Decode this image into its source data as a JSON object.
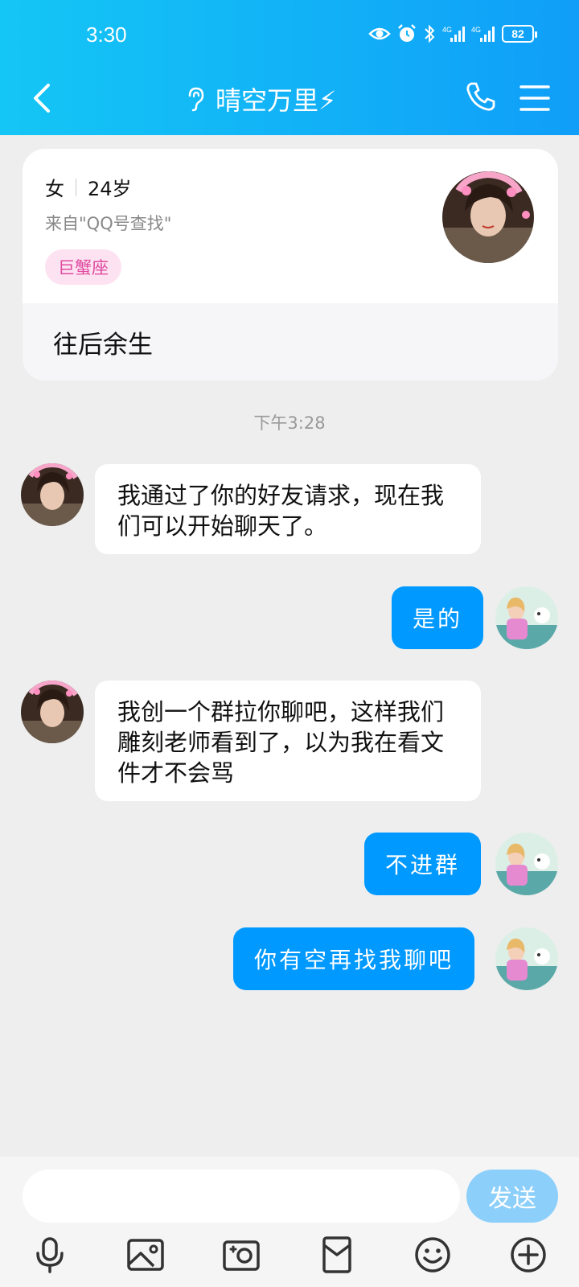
{
  "status_bar": {
    "time": "3:30",
    "battery": "82"
  },
  "header": {
    "title": "晴空万里⚡"
  },
  "profile": {
    "gender": "女",
    "age": "24岁",
    "source": "来自\"QQ号查找\"",
    "zodiac": "巨蟹座",
    "signature": "往后余生"
  },
  "chat": {
    "time_label": "下午3:28",
    "messages": [
      {
        "side": "left",
        "text": "我通过了你的好友请求，现在我们可以开始聊天了。"
      },
      {
        "side": "right",
        "text": "是的"
      },
      {
        "side": "left",
        "text": "我创一个群拉你聊吧，这样我们雕刻老师看到了，以为我在看文件才不会骂"
      },
      {
        "side": "right",
        "text": "不进群"
      },
      {
        "side": "right",
        "text": "你有空再找我聊吧"
      }
    ]
  },
  "composer": {
    "value": "",
    "send_label": "发送"
  },
  "toolbar": {
    "icons": [
      "mic-icon",
      "image-icon",
      "camera-icon",
      "red-packet-icon",
      "emoji-icon",
      "plus-icon"
    ]
  }
}
